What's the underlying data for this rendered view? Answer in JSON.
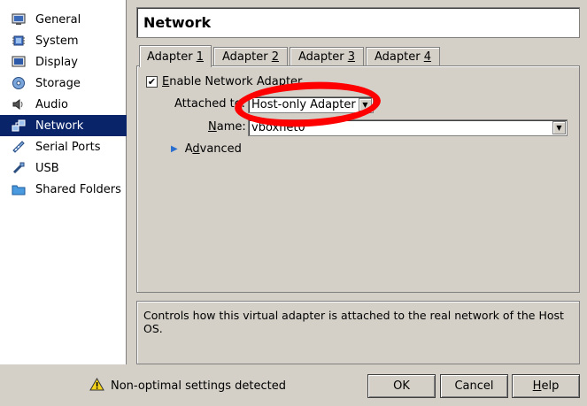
{
  "sidebar": {
    "items": [
      {
        "label": "General",
        "icon": "monitor-icon"
      },
      {
        "label": "System",
        "icon": "chip-icon"
      },
      {
        "label": "Display",
        "icon": "display-icon"
      },
      {
        "label": "Storage",
        "icon": "disk-icon"
      },
      {
        "label": "Audio",
        "icon": "speaker-icon"
      },
      {
        "label": "Network",
        "icon": "network-icon"
      },
      {
        "label": "Serial Ports",
        "icon": "serial-port-icon"
      },
      {
        "label": "USB",
        "icon": "usb-icon"
      },
      {
        "label": "Shared Folders",
        "icon": "folder-icon"
      }
    ],
    "selected": "Network"
  },
  "page_title": "Network",
  "tabs": [
    {
      "label_pre": "Adapter ",
      "label_key": "1"
    },
    {
      "label_pre": "Adapter ",
      "label_key": "2"
    },
    {
      "label_pre": "Adapter ",
      "label_key": "3"
    },
    {
      "label_pre": "Adapter ",
      "label_key": "4"
    }
  ],
  "adapter": {
    "enable_pre": "",
    "enable_key": "E",
    "enable_post": "nable Network Adapter",
    "enabled": true,
    "attached_label": "Attached to:",
    "attached_value": "Host-only Adapter",
    "name_key": "N",
    "name_post": "ame:",
    "name_value": "vboxnet0",
    "advanced_pre": "A",
    "advanced_key": "d",
    "advanced_post": "vanced"
  },
  "description": "Controls how this virtual adapter is attached to the real network of the Host OS.",
  "status": {
    "warning": "Non-optimal settings detected"
  },
  "buttons": {
    "ok": "OK",
    "cancel": "Cancel",
    "help_key": "H",
    "help_post": "elp"
  },
  "colors": {
    "selection": "#0a246a",
    "annotation": "#ff0000",
    "face": "#d4d0c8"
  }
}
